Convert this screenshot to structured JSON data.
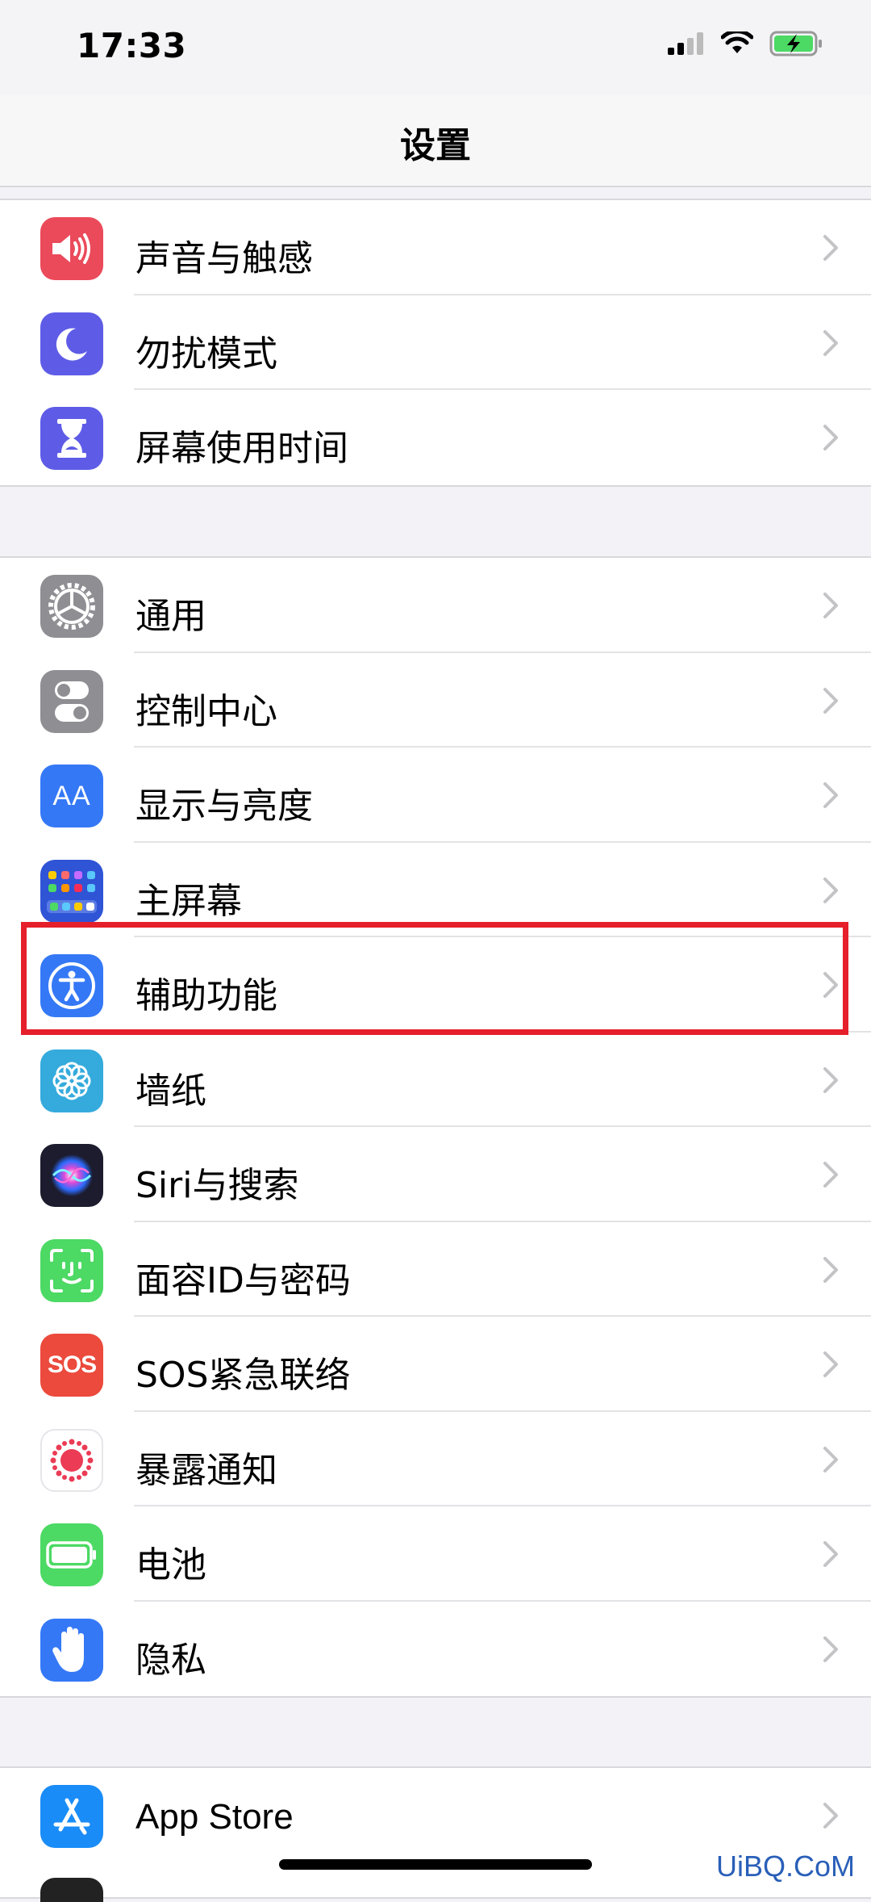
{
  "status_bar": {
    "time": "17:33",
    "icons": [
      "cellular-signal-icon",
      "wifi-icon",
      "battery-charging-icon"
    ]
  },
  "nav": {
    "title": "设置"
  },
  "groups": [
    {
      "items": [
        {
          "label": "声音与触感",
          "icon": "speaker-icon",
          "color": "#eb4a5a"
        },
        {
          "label": "勿扰模式",
          "icon": "moon-icon",
          "color": "#5e5ce6"
        },
        {
          "label": "屏幕使用时间",
          "icon": "hourglass-icon",
          "color": "#5e5ce6"
        }
      ]
    },
    {
      "items": [
        {
          "label": "通用",
          "icon": "gear-icon",
          "color": "#8e8e93"
        },
        {
          "label": "控制中心",
          "icon": "toggle-icon",
          "color": "#8e8e93"
        },
        {
          "label": "显示与亮度",
          "icon": "text-size-icon",
          "color": "#3478f6",
          "glyph": "AA"
        },
        {
          "label": "主屏幕",
          "icon": "home-grid-icon",
          "color": "#2f54d6"
        },
        {
          "label": "辅助功能",
          "icon": "accessibility-icon",
          "color": "#3478f6"
        },
        {
          "label": "墙纸",
          "icon": "flower-icon",
          "color": "#35aadc"
        },
        {
          "label": "Siri与搜索",
          "icon": "siri-icon",
          "color": "#1c1c2e"
        },
        {
          "label": "面容ID与密码",
          "icon": "face-id-icon",
          "color": "#4cd964"
        },
        {
          "label": "SOS紧急联络",
          "icon": "sos-icon",
          "color": "#eb4a3c",
          "glyph": "SOS"
        },
        {
          "label": "暴露通知",
          "icon": "exposure-icon",
          "color": "#ffffff"
        },
        {
          "label": "电池",
          "icon": "battery-icon",
          "color": "#4cd964"
        },
        {
          "label": "隐私",
          "icon": "hand-icon",
          "color": "#3478f6"
        }
      ]
    },
    {
      "items": [
        {
          "label": "App Store",
          "icon": "app-store-icon",
          "color": "#1a8cf7"
        }
      ]
    }
  ],
  "watermark": "UiBQ.CoM"
}
